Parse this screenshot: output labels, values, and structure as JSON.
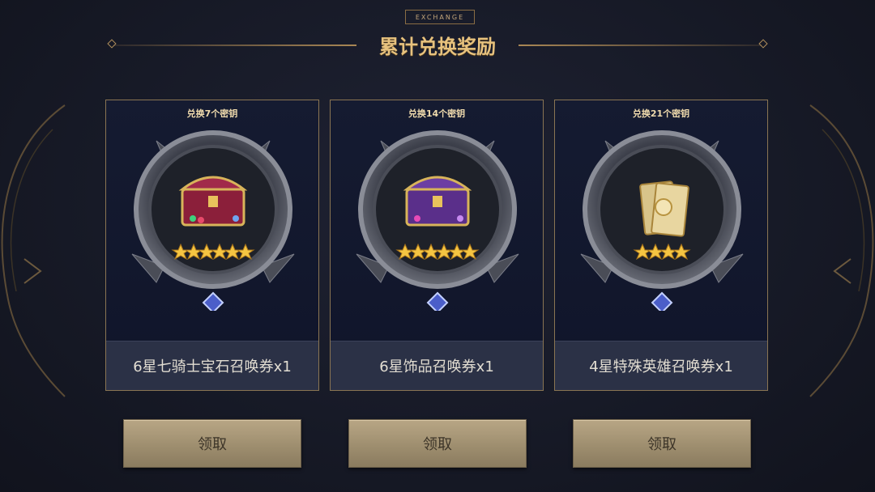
{
  "header": {
    "tag": "EXCHANGE",
    "title": "累计兑换奖励"
  },
  "rewards": [
    {
      "requirement": "兑换7个密钥",
      "name": "6星七骑士宝石召唤券x1",
      "stars": 6,
      "icon": "treasure-chest-red-icon",
      "claim_label": "领取"
    },
    {
      "requirement": "兑换14个密钥",
      "name": "6星饰品召唤券x1",
      "stars": 6,
      "icon": "treasure-chest-purple-icon",
      "claim_label": "领取"
    },
    {
      "requirement": "兑换21个密钥",
      "name": "4星特殊英雄召唤券x1",
      "stars": 4,
      "icon": "gold-card-icon",
      "claim_label": "领取"
    }
  ],
  "colors": {
    "gold": "#e7c27e",
    "card_border": "#8a7553",
    "button": "#9c8c6d"
  }
}
